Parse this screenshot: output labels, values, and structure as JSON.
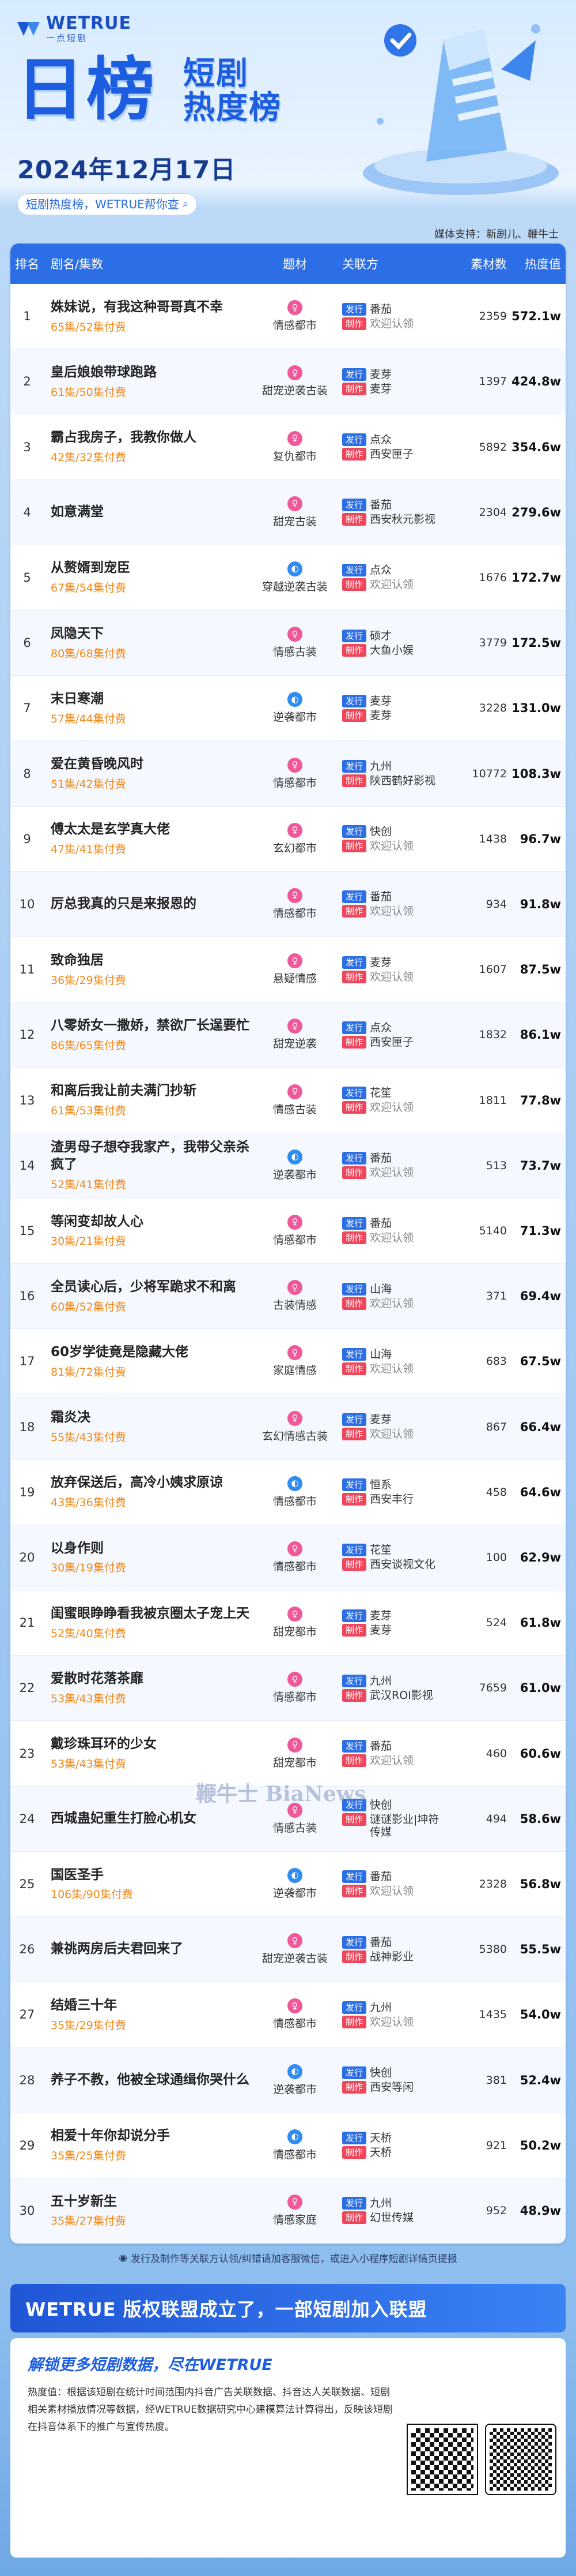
{
  "brand": {
    "en": "WETRUE",
    "cn": "一点短剧"
  },
  "title": {
    "big": "日榜",
    "small_line1": "短剧",
    "small_line2": "热度榜"
  },
  "date": "2024年12月17日",
  "slogan": "短剧热度榜，WETRUE帮你查",
  "slogan_icon": "magnifier-icon",
  "support": "媒体支持：新剧儿、鞭牛士",
  "table": {
    "headers": {
      "rank": "排名",
      "name": "剧名/集数",
      "genre": "题材",
      "parties": "关联方",
      "count": "素材数",
      "heat": "热度值"
    },
    "tag_publish": "发行",
    "tag_produce": "制作",
    "rows": [
      {
        "rank": "1",
        "name": "姝妹说，有我这种哥哥真不幸",
        "eps": "65集/52集付费",
        "genre": "情感都市",
        "genre_icon": "pink",
        "publisher": "番茄",
        "producer": "欢迎认领",
        "producer_muted": true,
        "count": "2359",
        "heat": "572.1w"
      },
      {
        "rank": "2",
        "name": "皇后娘娘带球跑路",
        "eps": "61集/50集付费",
        "genre": "甜宠逆袭古装",
        "genre_icon": "pink",
        "publisher": "麦芽",
        "producer": "麦芽",
        "producer_muted": false,
        "count": "1397",
        "heat": "424.8w"
      },
      {
        "rank": "3",
        "name": "霸占我房子，我教你做人",
        "eps": "42集/32集付费",
        "genre": "复仇都市",
        "genre_icon": "pink",
        "publisher": "点众",
        "producer": "西安匣子",
        "producer_muted": false,
        "count": "5892",
        "heat": "354.6w"
      },
      {
        "rank": "4",
        "name": "如意满堂",
        "eps": "",
        "genre": "甜宠古装",
        "genre_icon": "pink",
        "publisher": "番茄",
        "producer": "西安秋元影视",
        "producer_muted": false,
        "count": "2304",
        "heat": "279.6w"
      },
      {
        "rank": "5",
        "name": "从赘婿到宠臣",
        "eps": "67集/54集付费",
        "genre": "穿越逆袭古装",
        "genre_icon": "blue",
        "publisher": "点众",
        "producer": "欢迎认领",
        "producer_muted": true,
        "count": "1676",
        "heat": "172.7w"
      },
      {
        "rank": "6",
        "name": "凤隐天下",
        "eps": "80集/68集付费",
        "genre": "情感古装",
        "genre_icon": "pink",
        "publisher": "硕才",
        "producer": "大鱼小娱",
        "producer_muted": false,
        "count": "3779",
        "heat": "172.5w"
      },
      {
        "rank": "7",
        "name": "末日寒潮",
        "eps": "57集/44集付费",
        "genre": "逆袭都市",
        "genre_icon": "blue",
        "publisher": "麦芽",
        "producer": "麦芽",
        "producer_muted": false,
        "count": "3228",
        "heat": "131.0w"
      },
      {
        "rank": "8",
        "name": "爱在黄昏晚风时",
        "eps": "51集/42集付费",
        "genre": "情感都市",
        "genre_icon": "pink",
        "publisher": "九州",
        "producer": "陕西鹤好影视",
        "producer_muted": false,
        "count": "10772",
        "heat": "108.3w"
      },
      {
        "rank": "9",
        "name": "傅太太是玄学真大佬",
        "eps": "47集/41集付费",
        "genre": "玄幻都市",
        "genre_icon": "pink",
        "publisher": "快创",
        "producer": "欢迎认领",
        "producer_muted": true,
        "count": "1438",
        "heat": "96.7w"
      },
      {
        "rank": "10",
        "name": "厉总我真的只是来报恩的",
        "eps": "",
        "genre": "情感都市",
        "genre_icon": "pink",
        "publisher": "番茄",
        "producer": "欢迎认领",
        "producer_muted": true,
        "count": "934",
        "heat": "91.8w"
      },
      {
        "rank": "11",
        "name": "致命独居",
        "eps": "36集/29集付费",
        "genre": "悬疑情感",
        "genre_icon": "pink",
        "publisher": "麦芽",
        "producer": "欢迎认领",
        "producer_muted": true,
        "count": "1607",
        "heat": "87.5w"
      },
      {
        "rank": "12",
        "name": "八零娇女一撒娇，禁欲厂长逞要忙",
        "eps": "86集/65集付费",
        "genre": "甜宠逆袭",
        "genre_icon": "pink",
        "publisher": "点众",
        "producer": "西安匣子",
        "producer_muted": false,
        "count": "1832",
        "heat": "86.1w"
      },
      {
        "rank": "13",
        "name": "和离后我让前夫满门抄斩",
        "eps": "61集/53集付费",
        "genre": "情感古装",
        "genre_icon": "pink",
        "publisher": "花笙",
        "producer": "欢迎认领",
        "producer_muted": true,
        "count": "1811",
        "heat": "77.8w"
      },
      {
        "rank": "14",
        "name": "渣男母子想夺我家产，我带父亲杀疯了",
        "eps": "52集/41集付费",
        "genre": "逆袭都市",
        "genre_icon": "blue",
        "publisher": "番茄",
        "producer": "欢迎认领",
        "producer_muted": true,
        "count": "513",
        "heat": "73.7w"
      },
      {
        "rank": "15",
        "name": "等闲变却故人心",
        "eps": "30集/21集付费",
        "genre": "情感都市",
        "genre_icon": "pink",
        "publisher": "番茄",
        "producer": "欢迎认领",
        "producer_muted": true,
        "count": "5140",
        "heat": "71.3w"
      },
      {
        "rank": "16",
        "name": "全员读心后，少将军跪求不和离",
        "eps": "60集/52集付费",
        "genre": "古装情感",
        "genre_icon": "pink",
        "publisher": "山海",
        "producer": "欢迎认领",
        "producer_muted": true,
        "count": "371",
        "heat": "69.4w"
      },
      {
        "rank": "17",
        "name": "60岁学徒竟是隐藏大佬",
        "eps": "81集/72集付费",
        "genre": "家庭情感",
        "genre_icon": "pink",
        "publisher": "山海",
        "producer": "欢迎认领",
        "producer_muted": true,
        "count": "683",
        "heat": "67.5w"
      },
      {
        "rank": "18",
        "name": "霜炎决",
        "eps": "55集/43集付费",
        "genre": "玄幻情感古装",
        "genre_icon": "pink",
        "publisher": "麦芽",
        "producer": "欢迎认领",
        "producer_muted": true,
        "count": "867",
        "heat": "66.4w"
      },
      {
        "rank": "19",
        "name": "放弃保送后，高冷小姨求原谅",
        "eps": "43集/36集付费",
        "genre": "情感都市",
        "genre_icon": "blue",
        "publisher": "恒系",
        "producer": "西安丰行",
        "producer_muted": false,
        "count": "458",
        "heat": "64.6w"
      },
      {
        "rank": "20",
        "name": "以身作则",
        "eps": "30集/19集付费",
        "genre": "情感都市",
        "genre_icon": "pink",
        "publisher": "花笙",
        "producer": "西安谈视文化",
        "producer_muted": false,
        "count": "100",
        "heat": "62.9w"
      },
      {
        "rank": "21",
        "name": "闺蜜眼睁睁看我被京圈太子宠上天",
        "eps": "52集/40集付费",
        "genre": "甜宠都市",
        "genre_icon": "pink",
        "publisher": "麦芽",
        "producer": "麦芽",
        "producer_muted": false,
        "count": "524",
        "heat": "61.8w"
      },
      {
        "rank": "22",
        "name": "爱散时花落茶靡",
        "eps": "53集/43集付费",
        "genre": "情感都市",
        "genre_icon": "pink",
        "publisher": "九州",
        "producer": "武汉ROI影视",
        "producer_muted": false,
        "count": "7659",
        "heat": "61.0w"
      },
      {
        "rank": "23",
        "name": "戴珍珠耳环的少女",
        "eps": "53集/43集付费",
        "genre": "甜宠都市",
        "genre_icon": "pink",
        "publisher": "番茄",
        "producer": "欢迎认领",
        "producer_muted": true,
        "count": "460",
        "heat": "60.6w"
      },
      {
        "rank": "24",
        "name": "西城蛊妃重生打脸心机女",
        "eps": "",
        "genre": "情感古装",
        "genre_icon": "pink",
        "publisher": "快创",
        "producer": "谜谜影业|坤符传媒",
        "producer_muted": false,
        "count": "494",
        "heat": "58.6w"
      },
      {
        "rank": "25",
        "name": "国医圣手",
        "eps": "106集/90集付费",
        "genre": "逆袭都市",
        "genre_icon": "blue",
        "publisher": "番茄",
        "producer": "欢迎认领",
        "producer_muted": true,
        "count": "2328",
        "heat": "56.8w"
      },
      {
        "rank": "26",
        "name": "兼祧两房后夫君回来了",
        "eps": "",
        "genre": "甜宠逆袭古装",
        "genre_icon": "pink",
        "publisher": "番茄",
        "producer": "战神影业",
        "producer_muted": false,
        "count": "5380",
        "heat": "55.5w"
      },
      {
        "rank": "27",
        "name": "结婚三十年",
        "eps": "35集/29集付费",
        "genre": "情感都市",
        "genre_icon": "pink",
        "publisher": "九州",
        "producer": "欢迎认领",
        "producer_muted": true,
        "count": "1435",
        "heat": "54.0w"
      },
      {
        "rank": "28",
        "name": "养子不教，他被全球通缉你哭什么",
        "eps": "",
        "genre": "逆袭都市",
        "genre_icon": "blue",
        "publisher": "快创",
        "producer": "西安等闲",
        "producer_muted": false,
        "count": "381",
        "heat": "52.4w"
      },
      {
        "rank": "29",
        "name": "相爱十年你却说分手",
        "eps": "35集/25集付费",
        "genre": "情感都市",
        "genre_icon": "blue",
        "publisher": "天桥",
        "producer": "天桥",
        "producer_muted": false,
        "count": "921",
        "heat": "50.2w"
      },
      {
        "rank": "30",
        "name": "五十岁新生",
        "eps": "35集/27集付费",
        "genre": "情感家庭",
        "genre_icon": "pink",
        "publisher": "九州",
        "producer": "幻世传媒",
        "producer_muted": false,
        "count": "952",
        "heat": "48.9w"
      }
    ]
  },
  "footnote": "发行及制作等关联方认领/纠错请加客服微信，或进入小程序短剧详情页提报",
  "footer": {
    "banner": "WETRUE 版权联盟成立了，一部短剧加入联盟",
    "sub": "解锁更多短剧数据，尽在WETRUE",
    "desc": "热度值：根据该短剧在统计时间范围内抖音广告关联数据、抖音达人关联数据、短剧相关素材播放情况等数据，经WETRUE数据研究中心建模算法计算得出，反映该短剧在抖音体系下的推广与宣传热度。"
  },
  "watermark": "鞭牛士 BiaNews",
  "colors": {
    "primary": "#2c6ee6",
    "produce_tag": "#f0455a",
    "eps": "#f08a1c",
    "genre_pink": "#f0589a",
    "genre_blue": "#2f8cf0"
  }
}
